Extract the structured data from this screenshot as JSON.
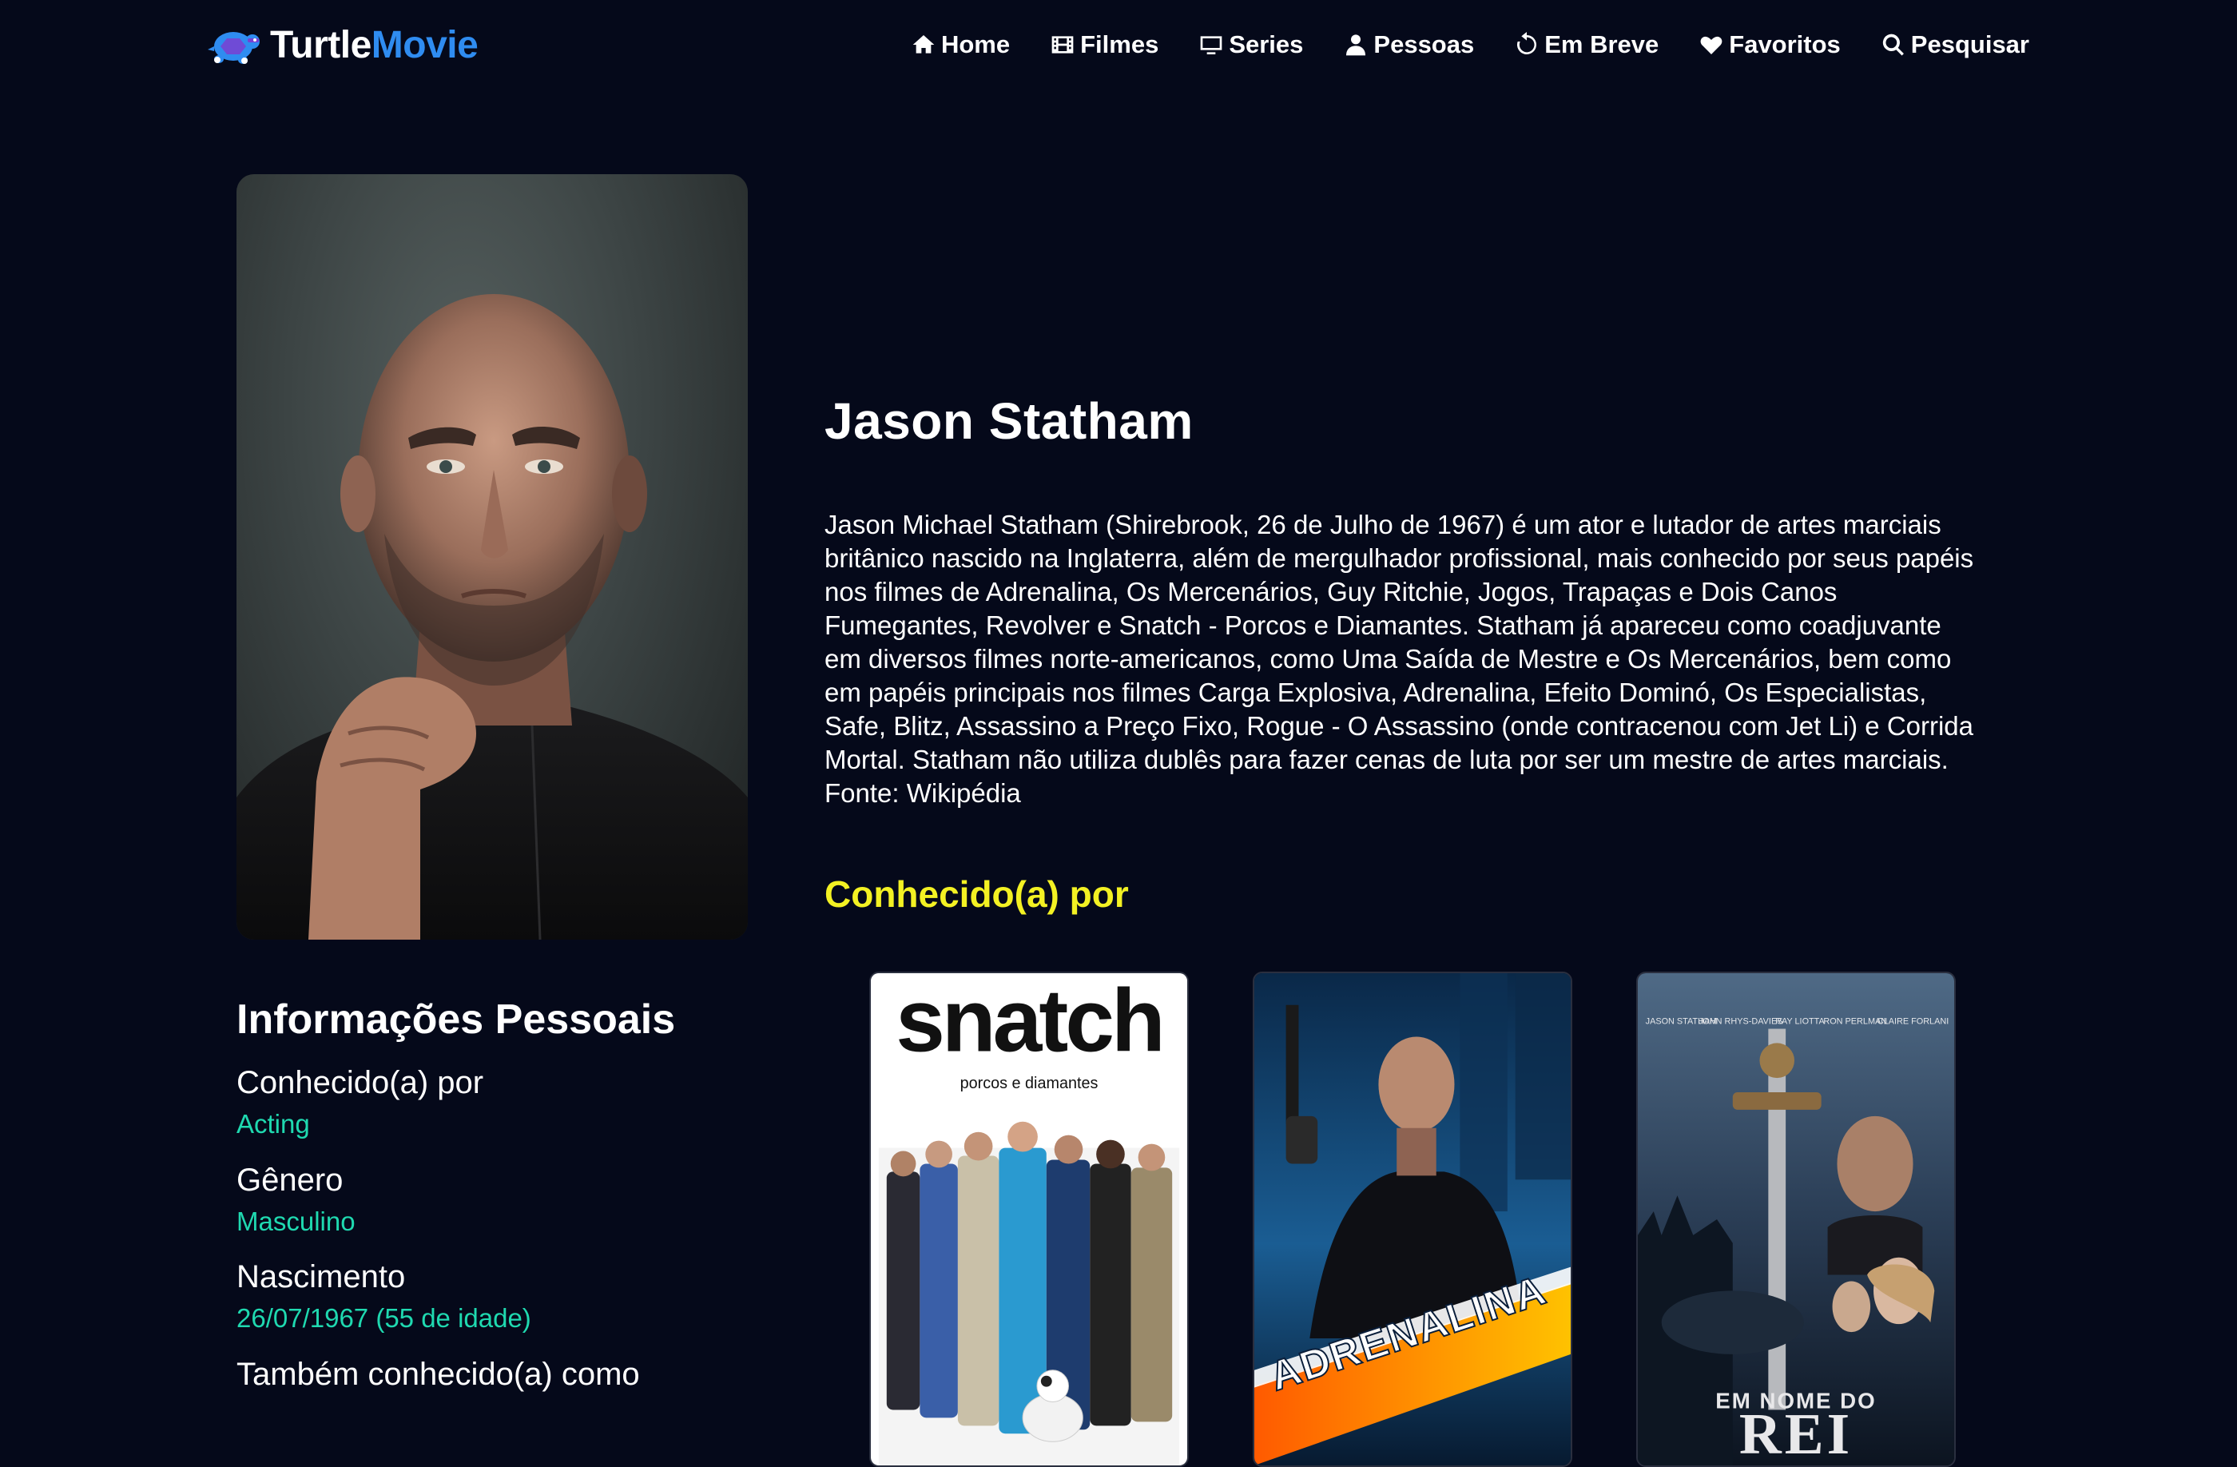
{
  "brand": {
    "part1": "Turtle",
    "part2": "Movie"
  },
  "nav": [
    {
      "label": "Home",
      "icon": "home-icon"
    },
    {
      "label": "Filmes",
      "icon": "film-icon"
    },
    {
      "label": "Series",
      "icon": "tv-icon"
    },
    {
      "label": "Pessoas",
      "icon": "person-icon"
    },
    {
      "label": "Em Breve",
      "icon": "history-icon"
    },
    {
      "label": "Favoritos",
      "icon": "heart-icon"
    },
    {
      "label": "Pesquisar",
      "icon": "search-icon"
    }
  ],
  "person": {
    "name": "Jason Statham",
    "bio": "Jason Michael Statham (Shirebrook, 26 de Julho de 1967) é um ator e lutador de artes marciais britânico nascido na Inglaterra, além de mergulhador profissional, mais conhecido por seus papéis nos filmes de Adrenalina, Os Mercenários, Guy Ritchie, Jogos, Trapaças e Dois Canos Fumegantes, Revolver e Snatch - Porcos e Diamantes. Statham já apareceu como coadjuvante em diversos filmes norte-americanos, como Uma Saída de Mestre e Os Mercenários, bem como em papéis principais nos filmes Carga Explosiva, Adrenalina, Efeito Dominó, Os Especialistas, Safe, Blitz, Assassino a Preço Fixo, Rogue - O Assassino (onde contracenou com Jet Li) e Corrida Mortal. Statham não utiliza dublês para fazer cenas de luta por ser um mestre de artes marciais. Fonte: Wikipédia"
  },
  "info": {
    "title": "Informações Pessoais",
    "rows": [
      {
        "label": "Conhecido(a) por",
        "value": "Acting"
      },
      {
        "label": "Gênero",
        "value": "Masculino"
      },
      {
        "label": "Nascimento",
        "value": "26/07/1967 (55 de idade)"
      },
      {
        "label": "Também conhecido(a) como",
        "value": ""
      }
    ]
  },
  "known_for": {
    "title": "Conhecido(a) por",
    "posters": [
      {
        "title": "snatch",
        "subtitle": "porcos e diamantes",
        "bg": "#ffffff"
      },
      {
        "title": "ADRENALINA",
        "bg": "#0d3a66"
      },
      {
        "title_top": "EM NOME DO",
        "title": "REI",
        "credits": [
          "JASON STATHAM",
          "JOHN RHYS-DAVIES",
          "RAY LIOTTA",
          "RON PERLMAN",
          "CLAIRE FORLANI"
        ],
        "bg": "#2c4460"
      }
    ]
  },
  "colors": {
    "background": "#05091a",
    "brand_accent": "#2f8cf0",
    "section_title": "#f3f123",
    "info_value": "#1fd9b0"
  }
}
